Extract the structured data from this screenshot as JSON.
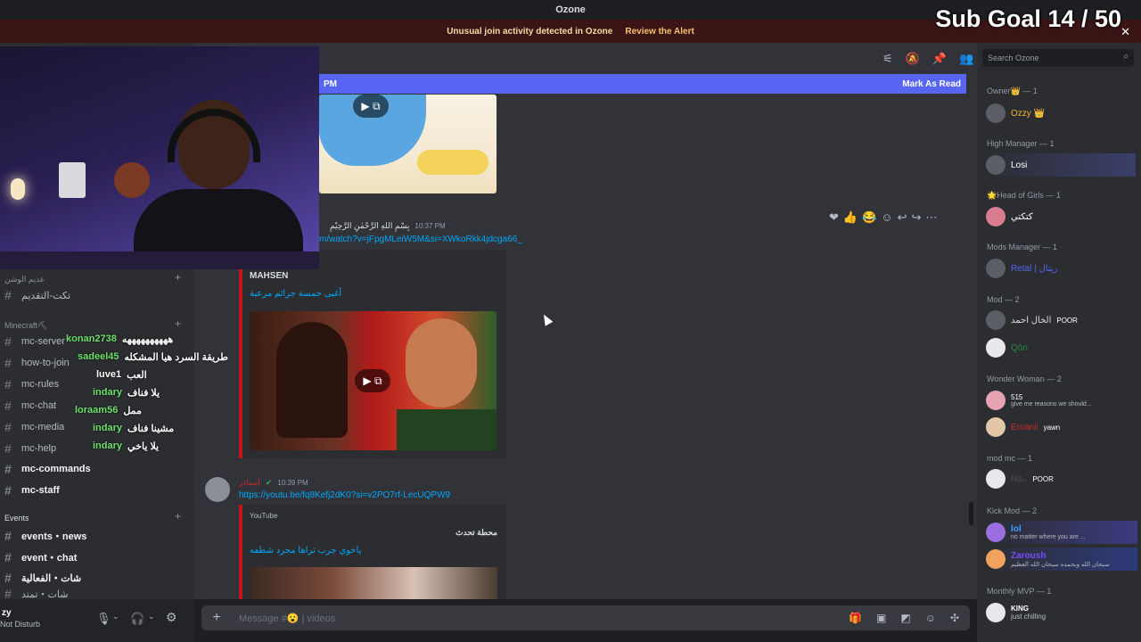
{
  "window": {
    "title": "Ozone"
  },
  "alert": {
    "text": "Unusual join activity detected in Ozone",
    "action": "Review the Alert"
  },
  "overlay_goal": {
    "text": "Sub Goal 14 / 50"
  },
  "header": {
    "search_placeholder": "Search Ozone"
  },
  "new_messages": {
    "since": "PM",
    "action": "Mark As Read"
  },
  "sidebar": {
    "cat_top": "عديم الوشن",
    "chan_top": "تكت-التقديم",
    "cat_minecraft": "Minecraft⛏",
    "channels": [
      {
        "label": "mc-server"
      },
      {
        "label": "how-to-join"
      },
      {
        "label": "mc-rules"
      },
      {
        "label": "mc-chat"
      },
      {
        "label": "mc-media"
      },
      {
        "label": "mc-help"
      },
      {
        "label": "mc-commands"
      },
      {
        "label": "mc-staff"
      }
    ],
    "cat_events": "Events",
    "event_channels": [
      {
        "label": "events・news"
      },
      {
        "label": "event・chat"
      },
      {
        "label": "شات・الفعالية"
      },
      {
        "label": "شات・تمتد"
      }
    ],
    "user": {
      "name": "zy",
      "status": "Not Disturb"
    }
  },
  "stream_chat": [
    {
      "user": "konan2738",
      "text": "ههههههههههه"
    },
    {
      "user": "sadeel45",
      "text": "طريقة السرد هيا المشكله"
    },
    {
      "user": "luve1",
      "text": "العب"
    },
    {
      "user": "indary",
      "text": "يلا فناف"
    },
    {
      "user": "loraam56",
      "text": "ممل"
    },
    {
      "user": "indary",
      "text": "مشينا فناف"
    },
    {
      "user": "indary",
      "text": "يلا ياخي"
    }
  ],
  "messages": [
    {
      "time": "10:37 PM",
      "author": "بِسْمِ اللهِ الرَّحْمٰنِ الرَّحِيْمِ",
      "link": "m/watch?v=jFpgMLeiW5M&si=XWkoRkk4jdcga66_",
      "embed_provider": "MAHSEN",
      "embed_title": "أغبى خمسة جرائم مرعبة"
    },
    {
      "time": "10:39 PM",
      "author": "أستاذر",
      "link": "https://youtu.be/fq8Kefj2dK0?si=v2PO7rf-LecUQPW9",
      "embed_provider": "YouTube",
      "embed_author": "محطة تحدث",
      "embed_title": "ياخوي جرب تراها مجرد شطفه"
    }
  ],
  "composer": {
    "placeholder": "Message #😮 | videos"
  },
  "members": {
    "roles": [
      {
        "name": "Owner👑 — 1",
        "members": [
          {
            "name": "Ozzy 👑",
            "color": "#f0b232"
          }
        ]
      },
      {
        "name": "High Manager — 1",
        "members": [
          {
            "name": "Losi",
            "color": "#ffffff"
          }
        ]
      },
      {
        "name": "🌟Head of Girls — 1",
        "members": [
          {
            "name": "كتكتي",
            "color": "#ffffff"
          }
        ]
      },
      {
        "name": "Mods Manager — 1",
        "members": [
          {
            "name": "Retal | ريتال",
            "color": "#5865f2"
          }
        ]
      },
      {
        "name": "Mod — 2",
        "members": [
          {
            "name": "الخال احمد",
            "color": "#dbdee1"
          },
          {
            "name": "Qōn",
            "color": "#2b8a3e"
          }
        ]
      },
      {
        "name": "Wonder Woman — 2",
        "members": [
          {
            "name": "515",
            "color": "#ffffff"
          },
          {
            "name": "Emanii",
            "color": "#c92a2a"
          }
        ]
      },
      {
        "name": "mod mc — 1",
        "members": [
          {
            "name": "No..",
            "color": "#ffffff"
          }
        ]
      },
      {
        "name": "Kick Mod — 2",
        "members": [
          {
            "name": "lol",
            "color": "#3ea0ff"
          },
          {
            "name": "Zaroush",
            "color": "#7c4dff"
          }
        ]
      },
      {
        "name": "Monthly MVP — 1",
        "members": [
          {
            "name": "KING",
            "color": "#ffffff"
          }
        ]
      }
    ],
    "status_texts": {
      "poor1": "POOR",
      "give_me": "give me reasons we should...",
      "yawn": "yawn",
      "poor2": "POOR",
      "no_matter": "no matter where you are ...",
      "subhan": "سبحان الله وبحمده سبحان الله العظيم",
      "chilling": "just chilling"
    }
  }
}
